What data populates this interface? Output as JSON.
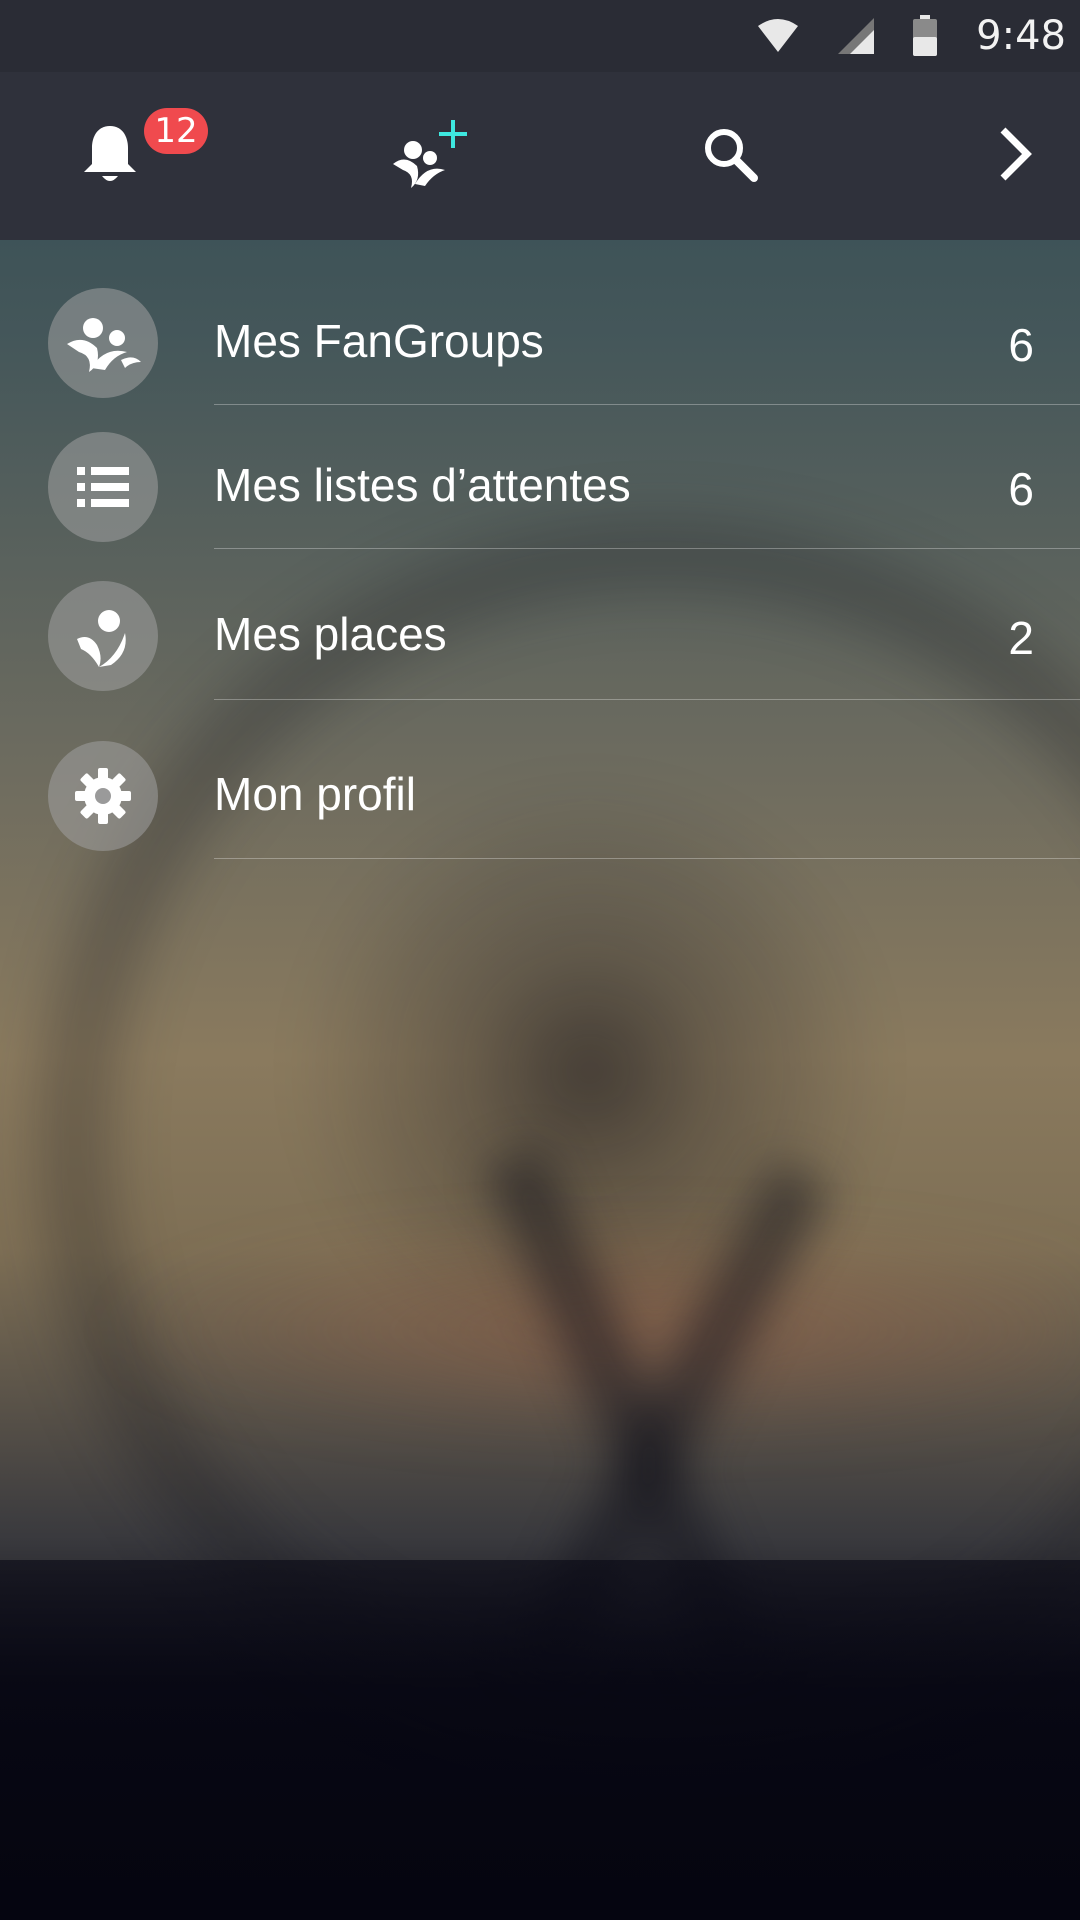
{
  "status_bar": {
    "time": "9:48",
    "icons": [
      "wifi-icon",
      "cell-signal-icon",
      "battery-icon"
    ]
  },
  "app_bar": {
    "notifications": {
      "icon": "bell-icon",
      "badge_count": "12"
    },
    "add_group": {
      "icon": "fangroup-add-icon",
      "accent_color": "#3ee8e0"
    },
    "search": {
      "icon": "search-icon"
    },
    "forward": {
      "icon": "chevron-right-icon"
    }
  },
  "menu": {
    "items": [
      {
        "label": "Mes FanGroups",
        "count": "6",
        "icon": "fangroups-icon"
      },
      {
        "label": "Mes listes d’attentes",
        "count": "6",
        "icon": "list-icon"
      },
      {
        "label": "Mes places",
        "count": "2",
        "icon": "person-place-icon"
      },
      {
        "label": "Mon profil",
        "count": "",
        "icon": "gear-icon"
      }
    ]
  },
  "colors": {
    "status_bar_bg": "#2a2c35",
    "app_bar_bg": "#2f313b",
    "badge_bg": "#f04a4e",
    "accent": "#3ee8e0"
  }
}
